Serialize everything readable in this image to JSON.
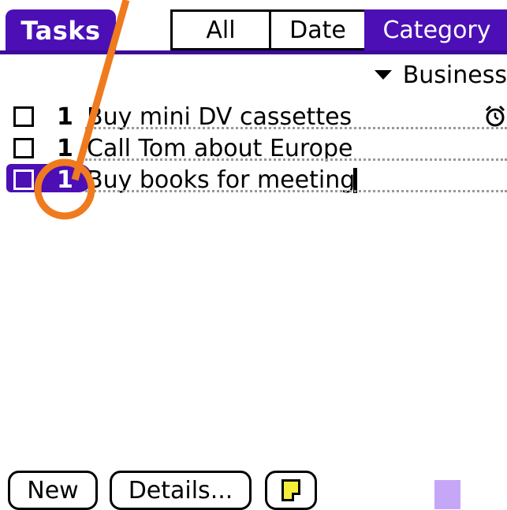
{
  "header": {
    "title": "Tasks",
    "tabs": [
      {
        "label": "All",
        "selected": false
      },
      {
        "label": "Date",
        "selected": false
      },
      {
        "label": "Category",
        "selected": true
      }
    ]
  },
  "category_picker": {
    "value": "Business",
    "icon": "triangle-down-icon"
  },
  "tasks": [
    {
      "priority": "1",
      "text": "Buy mini DV cassettes",
      "checked": false,
      "alarm": true,
      "selected": false
    },
    {
      "priority": "1",
      "text": "Call Tom about Europe",
      "checked": false,
      "alarm": false,
      "selected": false
    },
    {
      "priority": "1",
      "text": "Buy books for meeting",
      "checked": false,
      "alarm": false,
      "selected": true
    }
  ],
  "buttons": {
    "new_label": "New",
    "details_label": "Details...",
    "note_icon": "note-icon"
  },
  "colors": {
    "accent": "#4b0fb5",
    "annotation": "#f07a1e",
    "scroll_indicator": "#c6a6f6"
  }
}
